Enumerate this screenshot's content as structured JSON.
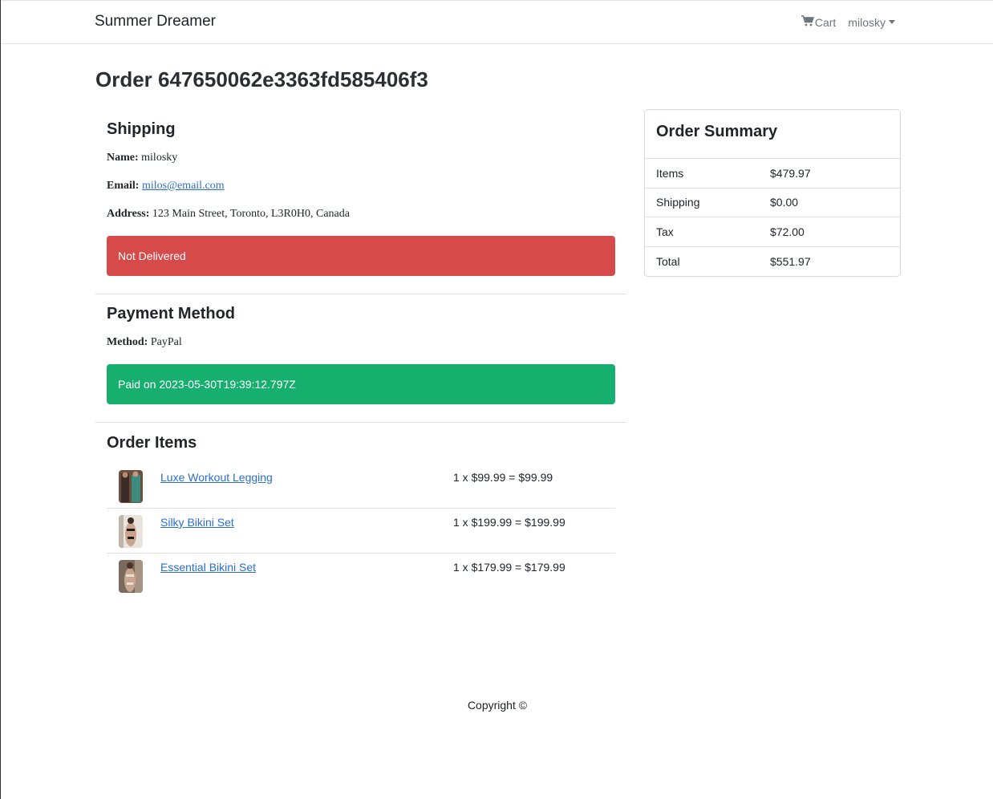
{
  "nav": {
    "brand": "Summer Dreamer",
    "cart_label": "Cart",
    "user_label": "milosky"
  },
  "page": {
    "title": "Order 647650062e3363fd585406f3"
  },
  "shipping": {
    "heading": "Shipping",
    "name_label": "Name:",
    "name_value": "milosky",
    "email_label": "Email:",
    "email_value": "milos@email.com",
    "address_label": "Address:",
    "address_value": "123 Main Street, Toronto, L3R0H0, Canada",
    "status": "Not Delivered"
  },
  "payment": {
    "heading": "Payment Method",
    "method_label": "Method:",
    "method_value": "PayPal",
    "status": "Paid on 2023-05-30T19:39:12.797Z"
  },
  "order_items": {
    "heading": "Order Items",
    "items": [
      {
        "name": "Luxe Workout Legging",
        "price": "1 x $99.99 = $99.99"
      },
      {
        "name": "Silky Bikini Set",
        "price": "1 x $199.99 = $199.99"
      },
      {
        "name": "Essential Bikini Set",
        "price": "1 x $179.99 = $179.99"
      }
    ]
  },
  "summary": {
    "heading": "Order Summary",
    "rows": [
      {
        "label": "Items",
        "value": "$479.97"
      },
      {
        "label": "Shipping",
        "value": "$0.00"
      },
      {
        "label": "Tax",
        "value": "$72.00"
      },
      {
        "label": "Total",
        "value": "$551.97"
      }
    ]
  },
  "footer": {
    "copyright": "Copyright ©"
  },
  "colors": {
    "danger": "#d64b4a",
    "success": "#17af6e",
    "link": "#2c6ecb"
  }
}
